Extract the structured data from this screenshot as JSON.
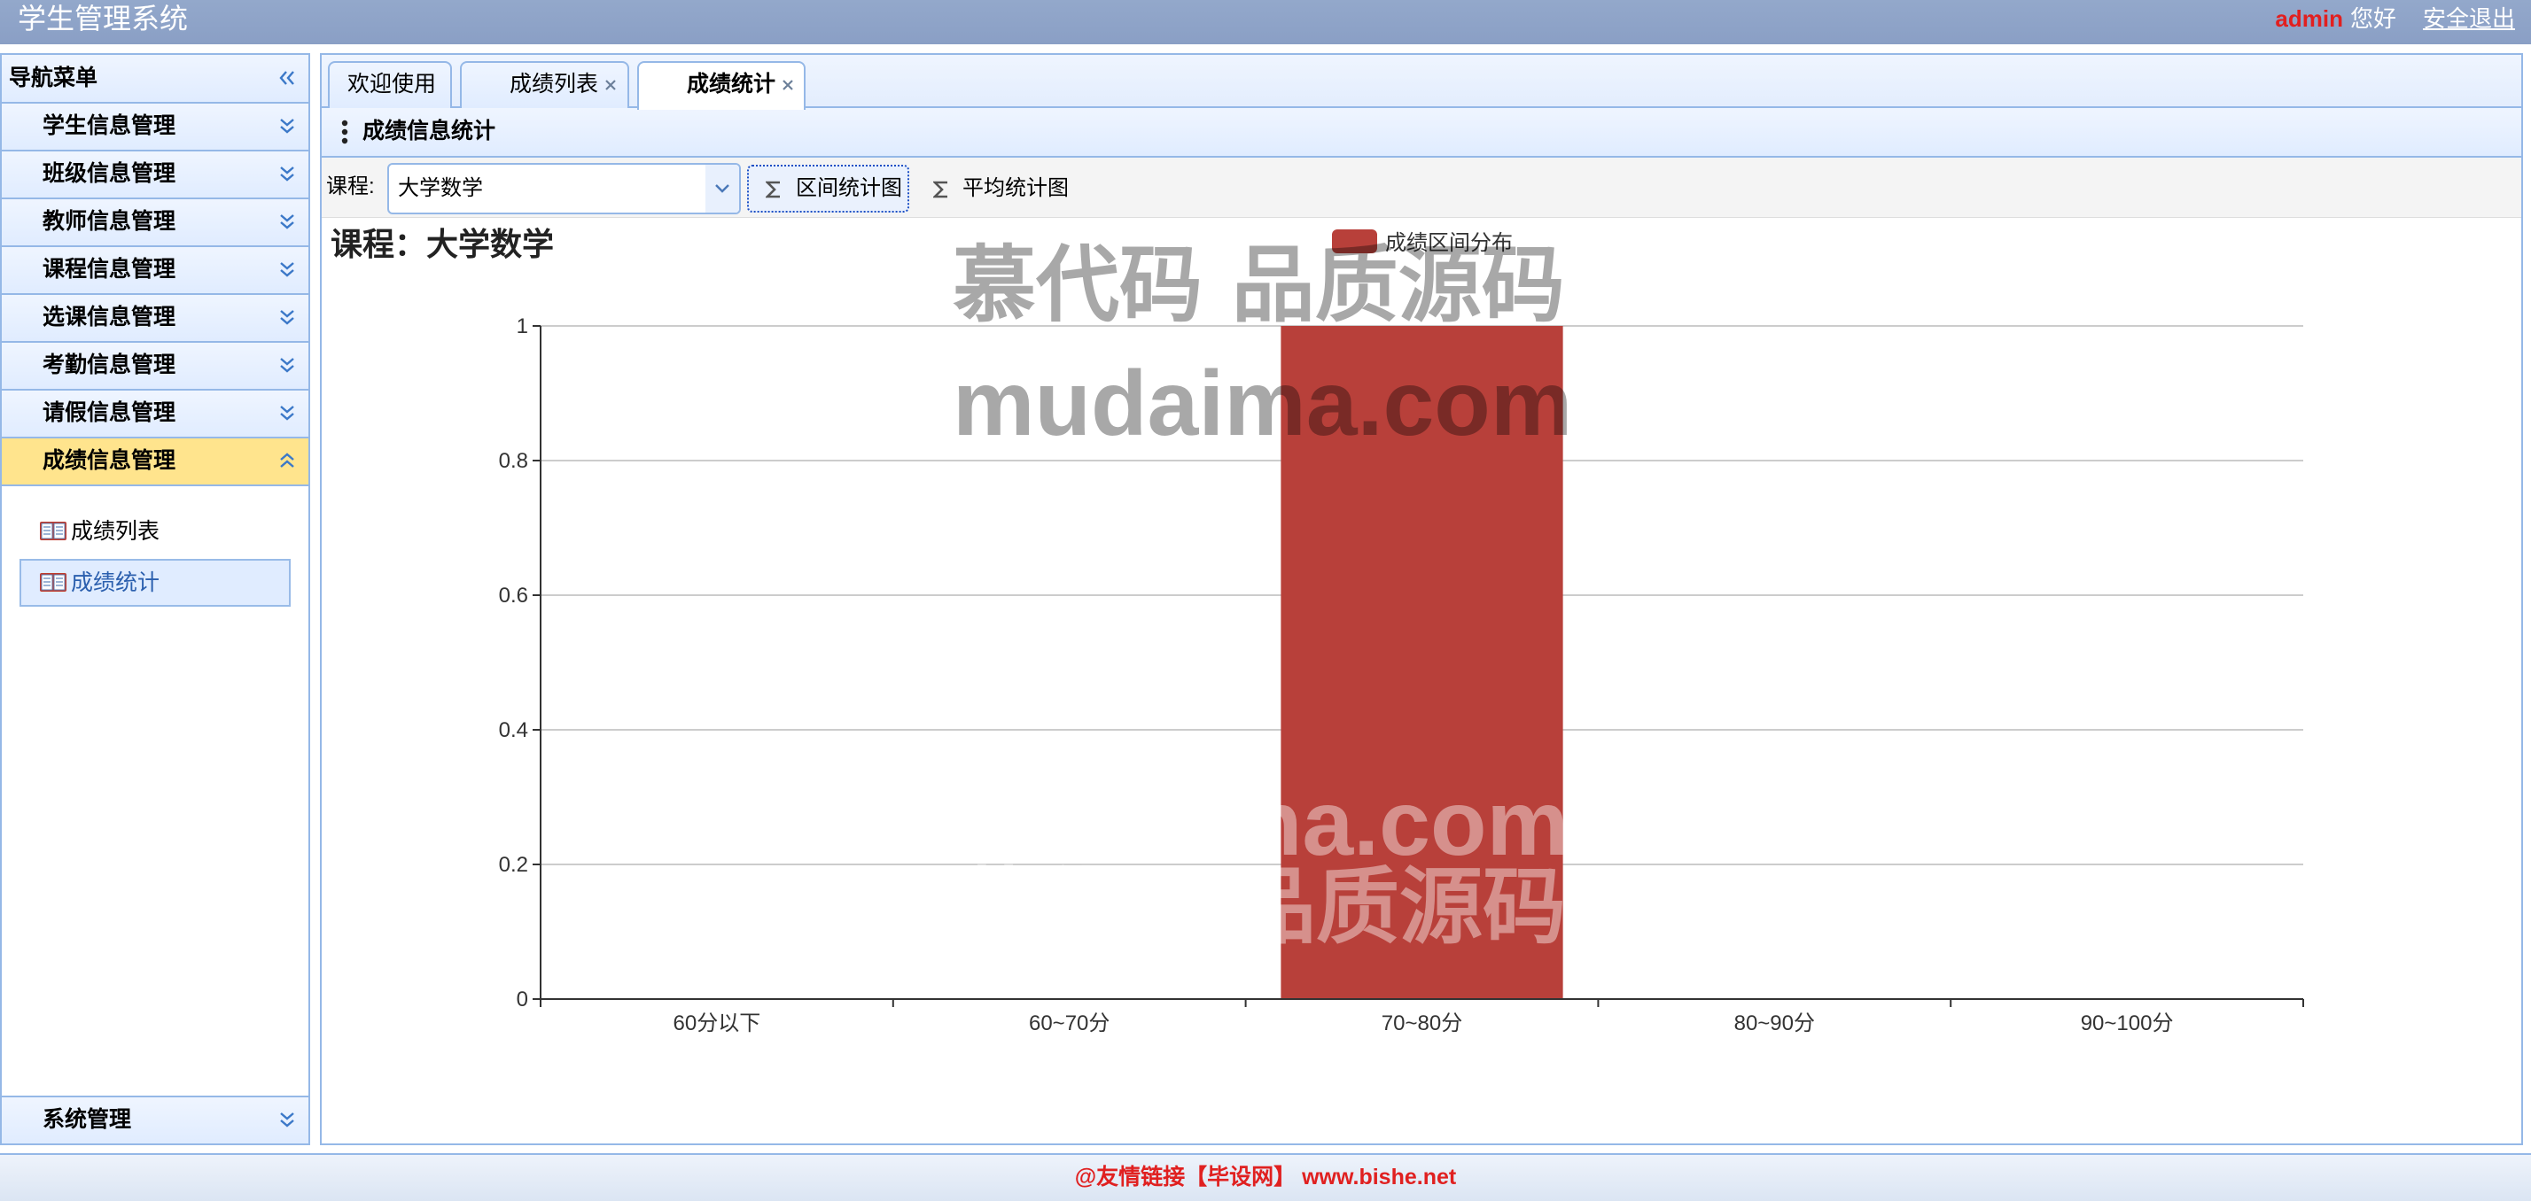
{
  "app": {
    "title": "学生管理系统"
  },
  "user": {
    "name": "admin",
    "greeting": "您好",
    "logout": "安全退出"
  },
  "sidebar": {
    "title": "导航菜单",
    "collapse_icon": "double-chevron-left-icon",
    "groups": [
      {
        "label": "学生信息管理",
        "icon": "double-chevron-down-icon"
      },
      {
        "label": "班级信息管理",
        "icon": "double-chevron-down-icon"
      },
      {
        "label": "教师信息管理",
        "icon": "double-chevron-down-icon"
      },
      {
        "label": "课程信息管理",
        "icon": "double-chevron-down-icon"
      },
      {
        "label": "选课信息管理",
        "icon": "double-chevron-down-icon"
      },
      {
        "label": "考勤信息管理",
        "icon": "double-chevron-down-icon"
      },
      {
        "label": "请假信息管理",
        "icon": "double-chevron-down-icon"
      },
      {
        "label": "成绩信息管理",
        "icon": "double-chevron-up-icon",
        "expanded": true,
        "items": [
          {
            "label": "成绩列表",
            "icon": "book-icon",
            "selected": false
          },
          {
            "label": "成绩统计",
            "icon": "book-icon",
            "selected": true
          }
        ]
      }
    ],
    "footer_group": {
      "label": "系统管理",
      "icon": "double-chevron-down-icon"
    }
  },
  "tabs": [
    {
      "label": "欢迎使用",
      "closable": false,
      "active": false
    },
    {
      "label": "成绩列表",
      "closable": true,
      "active": false
    },
    {
      "label": "成绩统计",
      "closable": true,
      "active": true
    }
  ],
  "panel": {
    "title": "成绩信息统计",
    "icon": "vertical-dots-icon"
  },
  "toolbar": {
    "course_label": "课程:",
    "course_value": "大学数学",
    "range_chart_button": "区间统计图",
    "average_chart_button": "平均统计图",
    "button_icon": "sigma-icon"
  },
  "chart_data": {
    "type": "bar",
    "title": "课程：大学数学",
    "categories": [
      "60分以下",
      "60~70分",
      "70~80分",
      "80~90分",
      "90~100分"
    ],
    "series": [
      {
        "name": "成绩区间分布",
        "values": [
          0,
          0,
          1,
          0,
          0
        ]
      }
    ],
    "ylim": [
      0,
      1
    ],
    "yticks": [
      0,
      0.2,
      0.4,
      0.6,
      0.8,
      1
    ],
    "grid": true,
    "legend": "top-center",
    "colors": [
      "#b8403a"
    ]
  },
  "watermark": {
    "line_cn": "慕代码 品质源码",
    "line_en": "mudaima.com"
  },
  "footer": {
    "text": "@友情链接【毕设网】 www.bishe.net"
  },
  "colors": {
    "header_bg": "#8a9fc5",
    "border": "#95b8e7",
    "active_group_bg": "#ffe48d",
    "selected_item_text": "#2b5fae",
    "username": "#e21f1f",
    "footer_text": "#e02020"
  }
}
